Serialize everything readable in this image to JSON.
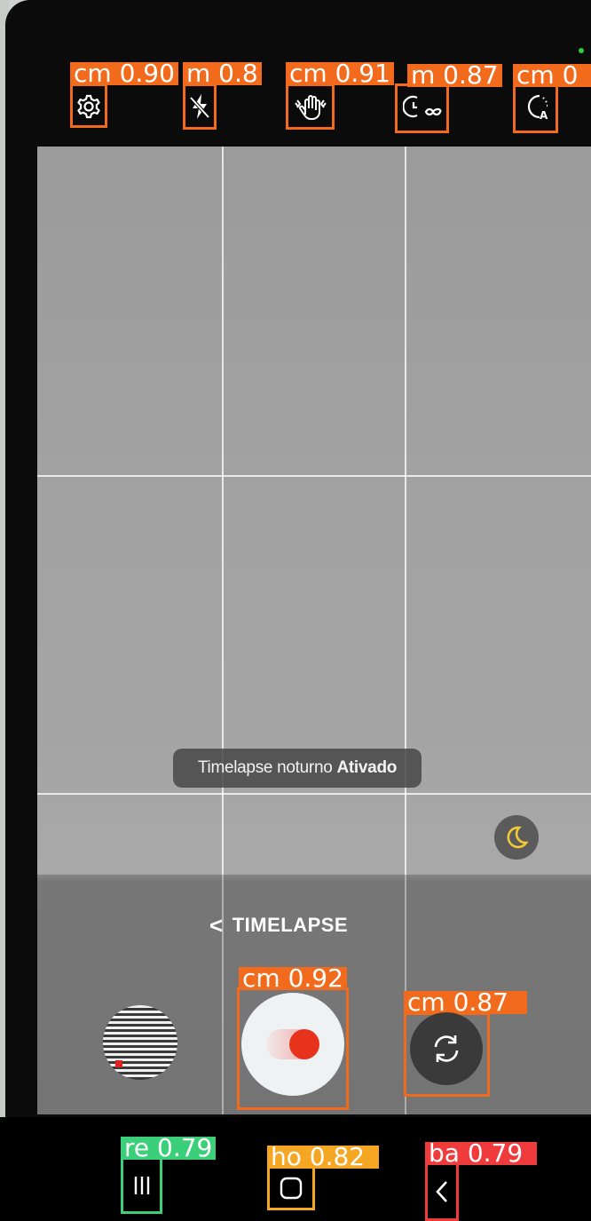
{
  "colors": {
    "detection_orange": "#f26a1b",
    "detection_green": "#3ccf7a",
    "detection_yellow": "#f5a623",
    "detection_red": "#ef3b3b",
    "record_red": "#e8331c",
    "indicator_green": "#2ecc40"
  },
  "topbar": {
    "settings": {
      "icon": "gear-icon",
      "label": "cm 0.90"
    },
    "flash": {
      "icon": "flash-off-icon",
      "label": "m 0.8"
    },
    "stabilize": {
      "icon": "hand-stabilize-icon",
      "label": "cm 0.91"
    },
    "timer": {
      "icon": "timer-infinite-icon",
      "label": "m 0.87"
    },
    "auto_mode": {
      "icon": "auto-exposure-icon",
      "label": "cm 0"
    }
  },
  "toast": {
    "text": "Timelapse noturno",
    "state": "Ativado"
  },
  "mode": {
    "chevron": "<",
    "label": "TIMELAPSE"
  },
  "shutter": {
    "label": "cm 0.92"
  },
  "switch_camera": {
    "icon": "switch-camera-icon",
    "label": "cm 0.87"
  },
  "nav": {
    "recents": {
      "icon": "recents-icon",
      "label": "re 0.79"
    },
    "home": {
      "icon": "home-icon",
      "label": "ho 0.82"
    },
    "back": {
      "icon": "back-icon",
      "label": "ba 0.79"
    }
  }
}
